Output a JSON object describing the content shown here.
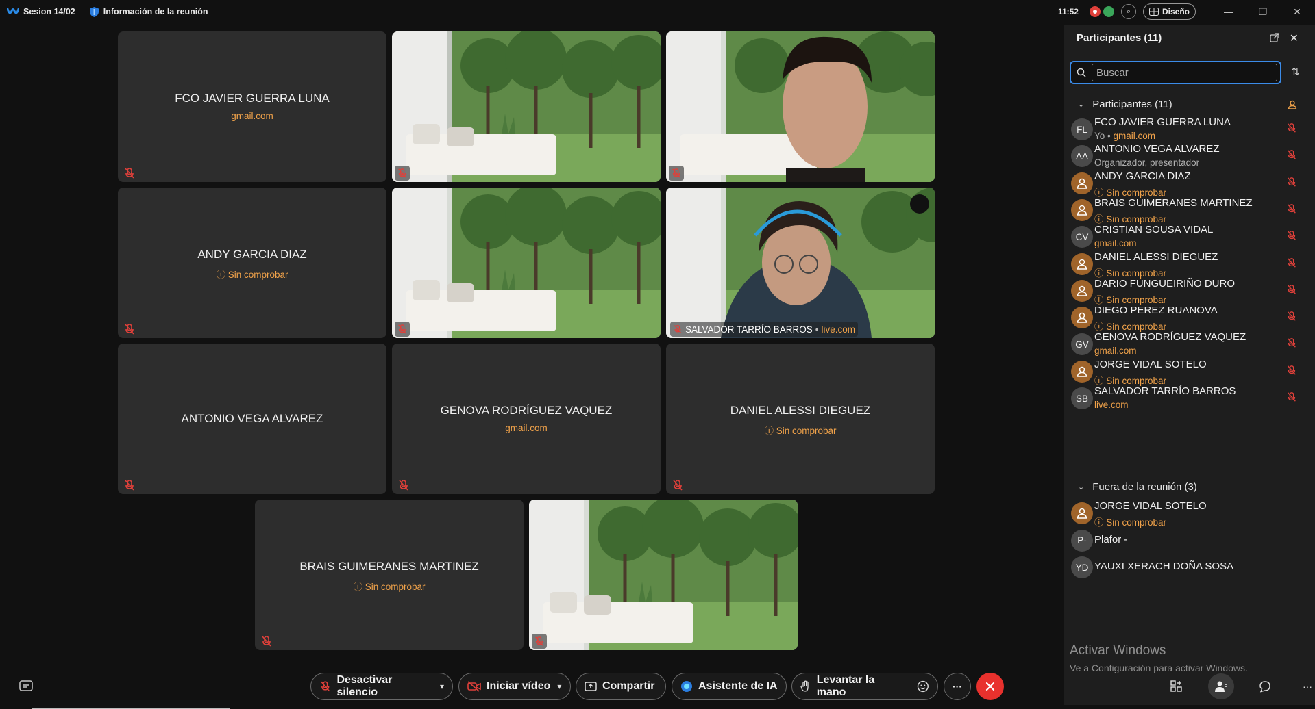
{
  "titlebar": {
    "session_label": "Sesion 14/02",
    "info_label": "Información de la reunión",
    "clock": "11:52",
    "layout_label": "Diseño"
  },
  "tiles": [
    {
      "name": "FCO JAVIER GUERRA LUNA",
      "sub": "gmail.com",
      "type": "avatar"
    },
    {
      "type": "video-room"
    },
    {
      "type": "video-person"
    },
    {
      "name": "ANDY GARCIA DIAZ",
      "sub": "Sin comprobar",
      "type": "avatar",
      "warn": true
    },
    {
      "type": "video-room"
    },
    {
      "type": "video-person2",
      "overlay_name": "SALVADOR TARRÍO BARROS",
      "overlay_domain": "live.com"
    },
    {
      "name": "ANTONIO VEGA ALVAREZ",
      "sub": "",
      "type": "avatar"
    },
    {
      "name": "GENOVA RODRÍGUEZ VAQUEZ",
      "sub": "gmail.com",
      "type": "avatar"
    },
    {
      "name": "DANIEL ALESSI DIEGUEZ",
      "sub": "Sin comprobar",
      "type": "avatar",
      "warn": true
    },
    {
      "name": "BRAIS GUIMERANES MARTINEZ",
      "sub": "Sin comprobar",
      "type": "avatar",
      "warn": true
    },
    {
      "type": "video-room"
    }
  ],
  "controls": {
    "mute": "Desactivar silencio",
    "video": "Iniciar vídeo",
    "share": "Compartir",
    "ai": "Asistente de IA",
    "raise_hand": "Levantar la mano",
    "more": "···"
  },
  "panel": {
    "title": "Participantes (11)",
    "search_placeholder": "Buscar",
    "group_in": "Participantes (11)",
    "group_out": "Fuera de la reunión (3)",
    "participants": [
      {
        "initials": "FL",
        "name": "FCO JAVIER GUERRA LUNA",
        "sub_prefix": "Yo • ",
        "sub": "gmail.com",
        "kind": "self"
      },
      {
        "initials": "AA",
        "name": "ANTONIO VEGA ALVAREZ",
        "sub": "Organizador, presentador",
        "kind": "host"
      },
      {
        "initials": "",
        "name": "ANDY GARCIA DIAZ",
        "sub": "Sin comprobar",
        "kind": "guest"
      },
      {
        "initials": "",
        "name": "BRAIS GUIMERANES MARTINEZ",
        "sub": "Sin comprobar",
        "kind": "guest"
      },
      {
        "initials": "CV",
        "name": "CRISTIAN SOUSA VIDAL",
        "sub": "gmail.com",
        "kind": "domain"
      },
      {
        "initials": "",
        "name": "DANIEL ALESSI DIEGUEZ",
        "sub": "Sin comprobar",
        "kind": "guest"
      },
      {
        "initials": "",
        "name": "DARIO FUNGUEIRIÑO DURO",
        "sub": "Sin comprobar",
        "kind": "guest"
      },
      {
        "initials": "",
        "name": "DIEGO PEREZ RUANOVA",
        "sub": "Sin comprobar",
        "kind": "guest"
      },
      {
        "initials": "GV",
        "name": "GENOVA RODRÍGUEZ VAQUEZ",
        "sub": "gmail.com",
        "kind": "domain"
      },
      {
        "initials": "",
        "name": "JORGE VIDAL SOTELO",
        "sub": "Sin comprobar",
        "kind": "guest"
      },
      {
        "initials": "SB",
        "name": "SALVADOR TARRÍO BARROS",
        "sub": "live.com",
        "kind": "domain"
      }
    ],
    "outside": [
      {
        "initials": "",
        "name": "JORGE VIDAL SOTELO",
        "sub": "Sin comprobar",
        "kind": "guest"
      },
      {
        "initials": "P-",
        "name": "Plafor -",
        "sub": "",
        "kind": "plain"
      },
      {
        "initials": "YD",
        "name": "YAUXI XERACH DOÑA SOSA",
        "sub": "",
        "kind": "plain"
      }
    ],
    "watermark_title": "Activar Windows",
    "watermark_sub": "Ve a Configuración para activar Windows."
  },
  "colors": {
    "accent_blue": "#3b8be8",
    "warning_orange": "#f0a24a",
    "end_red": "#e8312d",
    "mute_red": "#e0403a"
  }
}
